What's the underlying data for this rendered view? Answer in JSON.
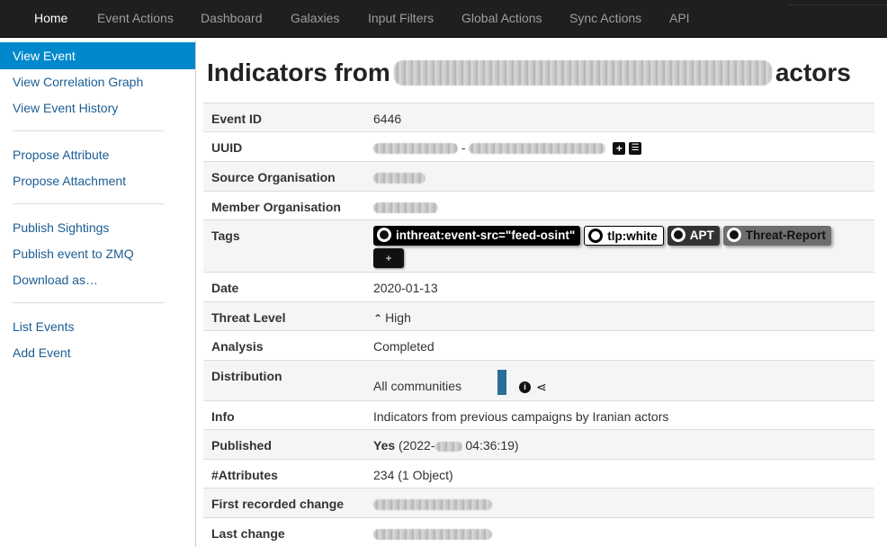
{
  "nav": {
    "items": [
      {
        "label": "Home",
        "active": true
      },
      {
        "label": "Event Actions"
      },
      {
        "label": "Dashboard"
      },
      {
        "label": "Galaxies"
      },
      {
        "label": "Input Filters"
      },
      {
        "label": "Global Actions"
      },
      {
        "label": "Sync Actions"
      },
      {
        "label": "API"
      }
    ]
  },
  "sidebar": {
    "items": [
      {
        "label": "View Event",
        "active": true
      },
      {
        "label": "View Correlation Graph"
      },
      {
        "label": "View Event History"
      },
      {
        "label": "Propose Attribute"
      },
      {
        "label": "Propose Attachment"
      },
      {
        "label": "Publish Sightings"
      },
      {
        "label": "Publish event to ZMQ"
      },
      {
        "label": "Download as…"
      },
      {
        "label": "List Events"
      },
      {
        "label": "Add Event"
      }
    ]
  },
  "page": {
    "title_prefix": "Indicators from",
    "title_suffix": "actors"
  },
  "details": {
    "event_id_label": "Event ID",
    "event_id": "6446",
    "uuid_label": "UUID",
    "uuid_fragment": "-",
    "uuid_add_icon": "+",
    "uuid_list_icon": "☰",
    "source_org_label": "Source Organisation",
    "member_org_label": "Member Organisation",
    "tags_label": "Tags",
    "tags": [
      {
        "name": "inthreat:event-src=\"feed-osint\"",
        "style": "dark"
      },
      {
        "name": "tlp:white",
        "style": "white"
      },
      {
        "name": "APT",
        "style": "grey"
      },
      {
        "name": "Threat-Report",
        "style": "grey2"
      }
    ],
    "add_tag_icon": "+",
    "date_label": "Date",
    "date": "2020-01-13",
    "threat_level_label": "Threat Level",
    "threat_level_icon": "⌃",
    "threat_level": "High",
    "analysis_label": "Analysis",
    "analysis": "Completed",
    "distribution_label": "Distribution",
    "distribution": "All communities",
    "distribution_info_icon": "i",
    "distribution_share_icon": "⋖",
    "info_label": "Info",
    "info": "Indicators from previous campaigns by Iranian actors",
    "published_label": "Published",
    "published": "Yes",
    "published_date_prefix": "(2022-",
    "published_date_suffix": " 04:36:19)",
    "attributes_label": "#Attributes",
    "attributes": "234 (1 Object)",
    "first_change_label": "First recorded change",
    "last_change_label": "Last change"
  }
}
